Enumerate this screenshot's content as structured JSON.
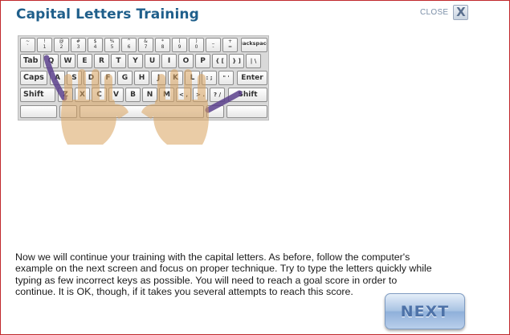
{
  "dialog": {
    "title": "Capital Letters Training",
    "close_label": "CLOSE",
    "close_icon": "X"
  },
  "keyboard": {
    "row1": [
      {
        "top": "~",
        "bottom": "`"
      },
      {
        "top": "!",
        "bottom": "1"
      },
      {
        "top": "@",
        "bottom": "2"
      },
      {
        "top": "#",
        "bottom": "3"
      },
      {
        "top": "$",
        "bottom": "4"
      },
      {
        "top": "%",
        "bottom": "5"
      },
      {
        "top": "^",
        "bottom": "6"
      },
      {
        "top": "&",
        "bottom": "7"
      },
      {
        "top": "*",
        "bottom": "8"
      },
      {
        "top": "(",
        "bottom": "9"
      },
      {
        "top": ")",
        "bottom": "0"
      },
      {
        "top": "_",
        "bottom": "-"
      },
      {
        "top": "+",
        "bottom": "="
      }
    ],
    "backspace": "Backspace",
    "tab": "Tab",
    "row2": [
      "Q",
      "W",
      "E",
      "R",
      "T",
      "Y",
      "U",
      "I",
      "O",
      "P",
      "{ [",
      "} ]",
      "| \\"
    ],
    "caps": "Caps",
    "row3": [
      "A",
      "S",
      "D",
      "F",
      "G",
      "H",
      "J",
      "K",
      "L",
      ": ;",
      "\" '"
    ],
    "enter": "Enter",
    "shift_left": "Shift",
    "row4": [
      "Z",
      "X",
      "C",
      "V",
      "B",
      "N",
      "M",
      "< ,",
      "> .",
      "? /"
    ],
    "shift_right": "Shift"
  },
  "instructions": "Now we will continue your training with the capital letters. As before, follow the computer's example on the next screen and focus on proper technique. Try to type the letters quickly while typing as few incorrect keys as possible. You will need to reach a goal score in order to continue. It is OK, though, if it takes you several attempts to reach this score.",
  "next_button": {
    "label": "NEXT"
  },
  "colors": {
    "title": "#1f5f8b",
    "border": "#c0282c",
    "finger_highlight": "#5a3f8c",
    "hand_skin": "#d9a35f"
  }
}
